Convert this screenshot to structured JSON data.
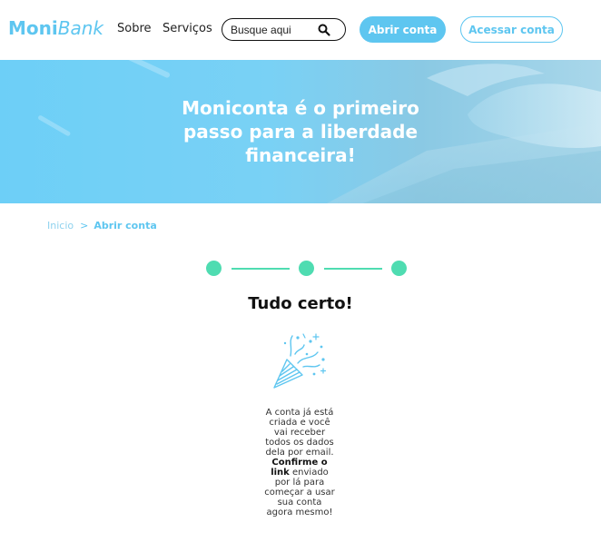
{
  "header": {
    "logo_bold": "Moni",
    "logo_italic": "Bank",
    "nav": [
      "Sobre",
      "Serviços"
    ],
    "search_placeholder": "Busque aqui",
    "open_account_label": "Abrir conta",
    "access_account_label": "Acessar conta"
  },
  "hero": {
    "title": "Moniconta é o primeiro passo para a liberdade financeira!"
  },
  "breadcrumb": {
    "home": "Inicio",
    "separator": ">",
    "current": "Abrir conta"
  },
  "steps": {
    "total": 3,
    "completed": 3
  },
  "confirmation": {
    "title": "Tudo certo!",
    "message_before": "A conta já está criada e você vai receber todos os dados dela por email.",
    "message_bold": "Confirme o link",
    "message_after": "enviado por lá para começar a usar sua conta agora mesmo!"
  },
  "colors": {
    "brand": "#5ec6f0",
    "step_accent": "#4fdcb1",
    "text": "#222222"
  },
  "icons": [
    "search-icon",
    "party-popper-icon"
  ]
}
